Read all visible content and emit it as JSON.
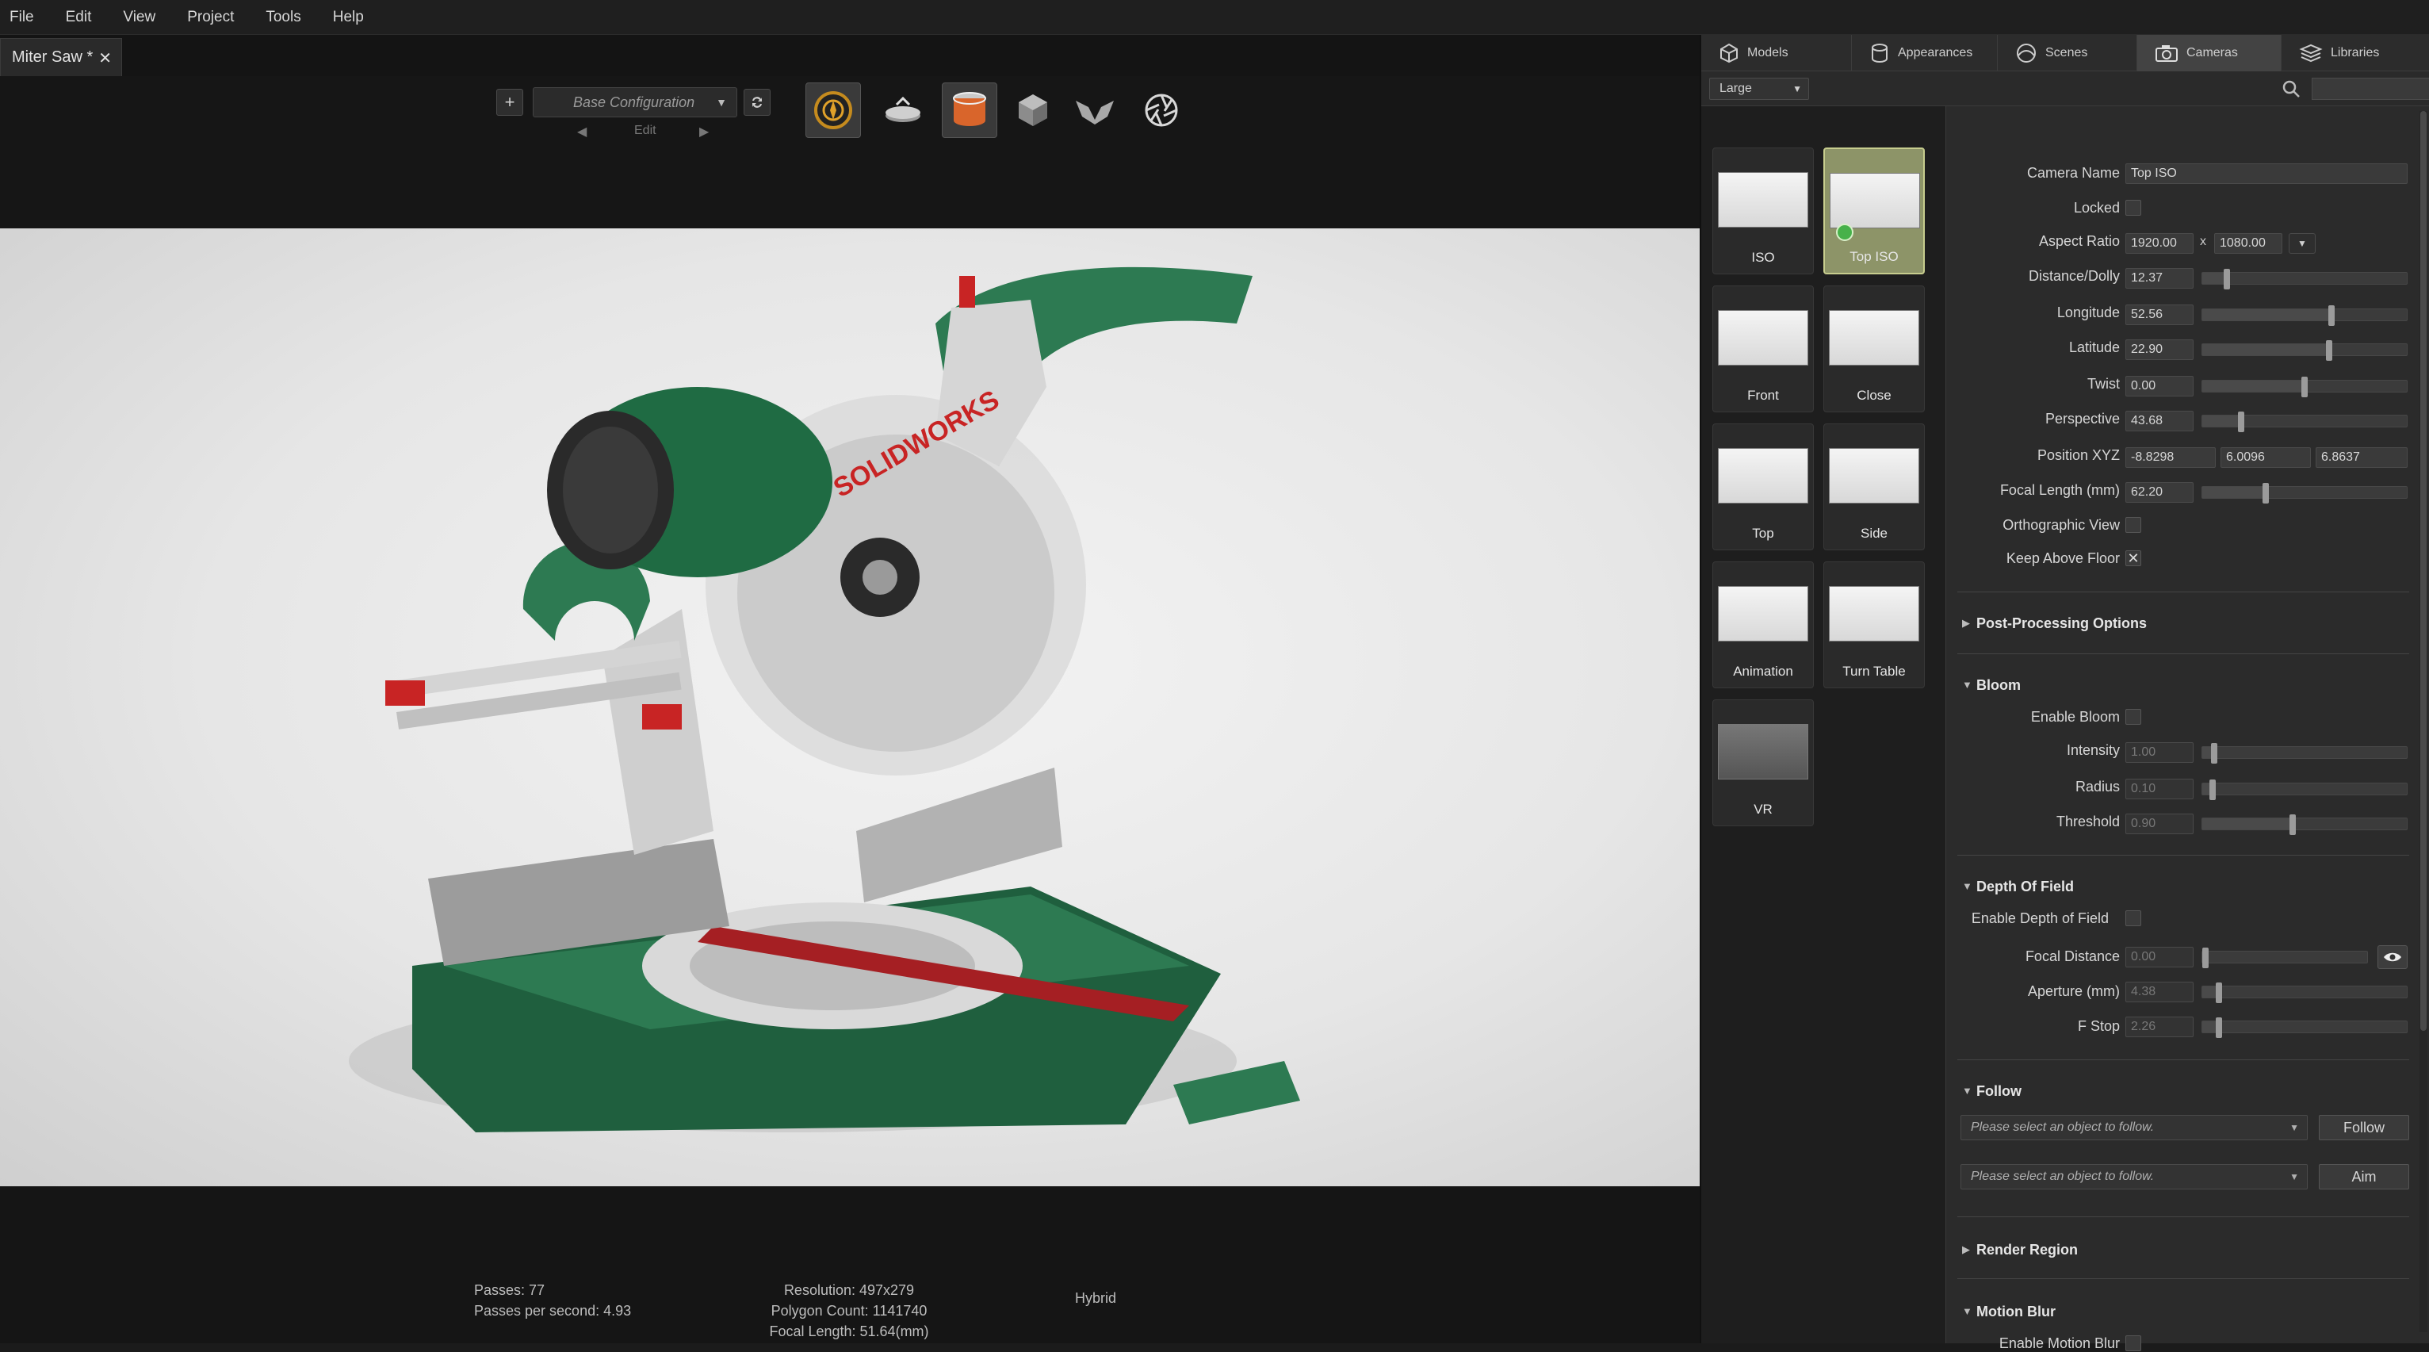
{
  "menu": [
    "File",
    "Edit",
    "View",
    "Project",
    "Tools",
    "Help"
  ],
  "document_tab": {
    "title": "Miter Saw *",
    "close": "✕"
  },
  "toolbar": {
    "add_label": "+",
    "configuration": "Base Configuration",
    "edit_label": "Edit",
    "prev": "◀",
    "next": "▶"
  },
  "status": {
    "passes": "Passes: 77",
    "passes_per_second": "Passes per second: 4.93",
    "resolution": "Resolution: 497x279",
    "polygon_count": "Polygon Count: 1141740",
    "focal_length": "Focal Length: 51.64(mm)",
    "mode": "Hybrid"
  },
  "library_tabs": [
    "Models",
    "Appearances",
    "Scenes",
    "Cameras",
    "Libraries"
  ],
  "active_library_tab": "Cameras",
  "thumbnail_size": "Large",
  "cameras": [
    "ISO",
    "Top ISO",
    "Front",
    "Close",
    "Top",
    "Side",
    "Animation",
    "Turn Table",
    "VR"
  ],
  "selected_camera": "Top ISO",
  "props": {
    "camera_name_label": "Camera Name",
    "camera_name": "Top ISO",
    "locked_label": "Locked",
    "aspect_label": "Aspect Ratio",
    "aspect_w": "1920.00",
    "aspect_x": "x",
    "aspect_h": "1080.00",
    "distance_label": "Distance/Dolly",
    "distance": "12.37",
    "longitude_label": "Longitude",
    "longitude": "52.56",
    "latitude_label": "Latitude",
    "latitude": "22.90",
    "twist_label": "Twist",
    "twist": "0.00",
    "perspective_label": "Perspective",
    "perspective": "43.68",
    "position_label": "Position XYZ",
    "pos_x": "-8.8298",
    "pos_y": "6.0096",
    "pos_z": "6.8637",
    "focal_label": "Focal Length (mm)",
    "focal": "62.20",
    "ortho_label": "Orthographic View",
    "keep_floor_label": "Keep Above Floor",
    "keep_floor_mark": "✕"
  },
  "post_processing": {
    "title": "Post-Processing Options"
  },
  "bloom": {
    "title": "Bloom",
    "enable_label": "Enable Bloom",
    "intensity_label": "Intensity",
    "intensity": "1.00",
    "radius_label": "Radius",
    "radius": "0.10",
    "threshold_label": "Threshold",
    "threshold": "0.90"
  },
  "dof": {
    "title": "Depth Of Field",
    "enable_label": "Enable Depth of Field",
    "focal_distance_label": "Focal Distance",
    "focal_distance": "0.00",
    "aperture_label": "Aperture (mm)",
    "aperture": "4.38",
    "fstop_label": "F Stop",
    "fstop": "2.26"
  },
  "follow": {
    "title": "Follow",
    "placeholder1": "Please select an object to follow.",
    "placeholder2": "Please select an object to follow.",
    "follow_btn": "Follow",
    "aim_btn": "Aim"
  },
  "render_region": {
    "title": "Render Region"
  },
  "motion_blur": {
    "title": "Motion Blur",
    "enable_label": "Enable Motion Blur"
  },
  "slider_values": {
    "distance": 0.12,
    "longitude": 0.63,
    "latitude": 0.62,
    "twist": 0.5,
    "perspective": 0.19,
    "focal": 0.31,
    "intensity": 0.06,
    "radius": 0.05,
    "threshold": 0.44,
    "focal_distance": 0.0,
    "aperture": 0.08,
    "fstop": 0.08
  }
}
